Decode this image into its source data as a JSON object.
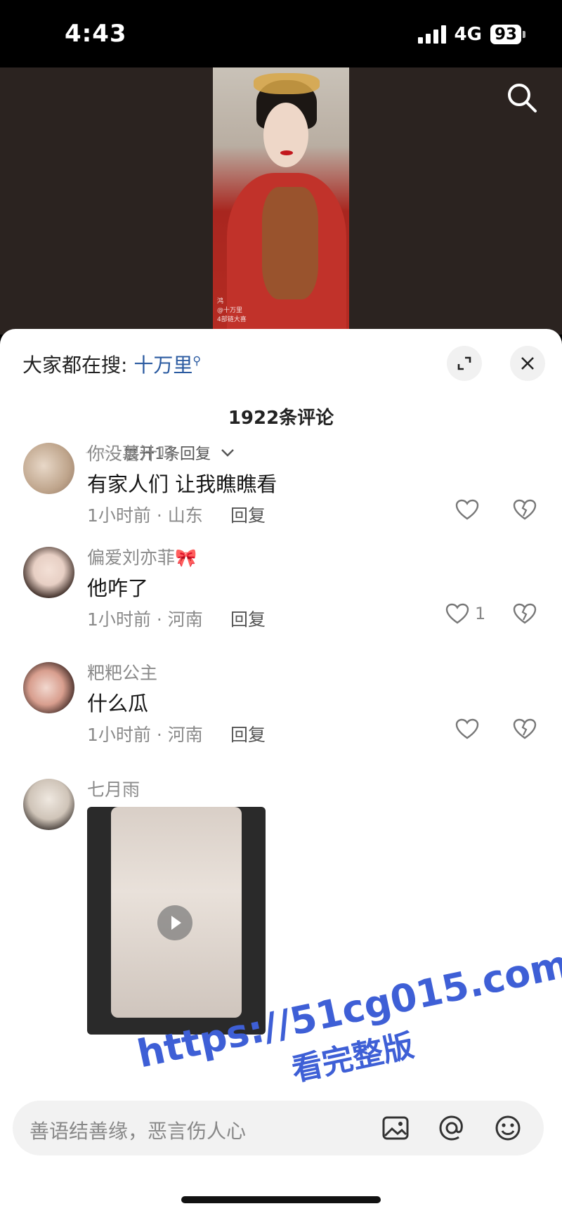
{
  "status_bar": {
    "time": "4:43",
    "network": "4G",
    "battery": "93"
  },
  "video": {
    "caption_lines": [
      "鸿",
      "@十万里",
      "4部链大喜"
    ]
  },
  "panel": {
    "hot_search_prefix": "大家都在搜: ",
    "hot_search_keyword": "十万里",
    "comment_count": "1922条评论",
    "expand_replies": "展开1条回复"
  },
  "comments": [
    {
      "user": "你没薯汁吗",
      "text": "有家人们 让我瞧瞧看",
      "meta": "1小时前 · 山东",
      "reply": "回复",
      "likes": ""
    },
    {
      "user": "偏爱刘亦菲🎀",
      "text": "他咋了",
      "meta": "1小时前 · 河南",
      "reply": "回复",
      "likes": "1"
    },
    {
      "user": "粑粑公主",
      "text": "什么瓜",
      "meta": "1小时前 · 河南",
      "reply": "回复",
      "likes": ""
    },
    {
      "user": "七月雨",
      "text": "",
      "meta": "",
      "reply": "",
      "likes": ""
    }
  ],
  "input": {
    "placeholder": "善语结善缘，恶言伤人心"
  },
  "watermark": {
    "line1": "https://51cg015.com",
    "line2": "看完整版"
  },
  "colors": {
    "keyword": "#2a5aa0",
    "panel_bg": "#ffffff",
    "video_bg": "#2b2320",
    "watermark": "#3e5fd6"
  }
}
